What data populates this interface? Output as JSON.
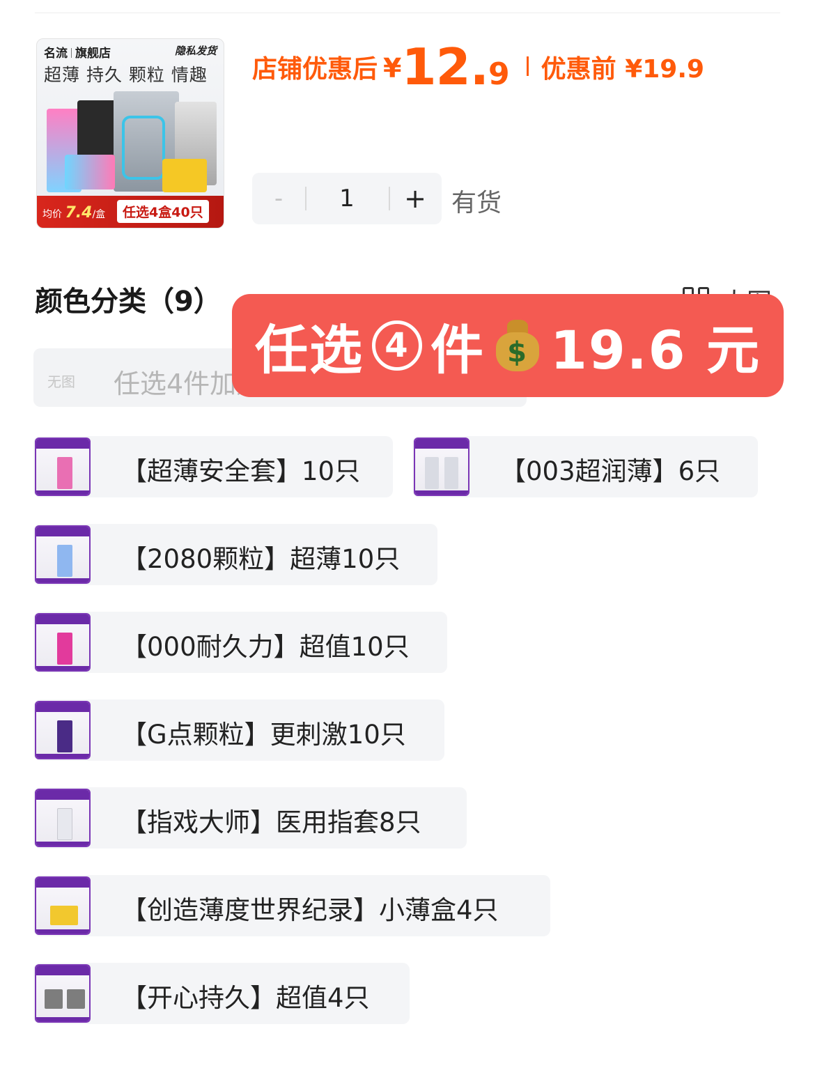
{
  "product": {
    "thumbnail": {
      "brand": "名流",
      "store": "旗舰店",
      "shipping": "隐私发货",
      "slogan": "超薄 持久 颗粒 情趣",
      "avg_price_label": "均价",
      "avg_price_value": "7.4",
      "avg_price_unit": "/盒",
      "promo_text": "任选4盒40只"
    },
    "price": {
      "after_label": "店铺优惠后",
      "currency": "¥",
      "after_int": "12.",
      "after_dec": "9",
      "before_label": "优惠前",
      "before_value": "¥19.9"
    },
    "stepper": {
      "minus": "-",
      "quantity": "1",
      "plus": "+"
    },
    "stock": "有货"
  },
  "category": {
    "title": "颜色分类（9）",
    "view_toggle": "大图",
    "selected_placeholder_img": "无图",
    "selected_text": "任选4件加购后去购物车结算",
    "options": [
      {
        "label": "【超薄安全套】10只",
        "pack_color": "#e96fb3"
      },
      {
        "label": "【003超润薄】6只",
        "pack_color": "#d9dbe3"
      },
      {
        "label": "【2080颗粒】超薄10只",
        "pack_color": "#8fb7f0"
      },
      {
        "label": "【000耐久力】超值10只",
        "pack_color": "#e23a9c"
      },
      {
        "label": "【G点颗粒】更刺激10只",
        "pack_color": "#4a2b86"
      },
      {
        "label": "【指戏大师】医用指套8只",
        "pack_color": "#e7e8ee"
      },
      {
        "label": "【创造薄度世界纪录】小薄盒4只",
        "pack_color": "#f2c82e"
      },
      {
        "label": "【开心持久】超值4只",
        "pack_color": "#7d7d7d"
      }
    ]
  },
  "promo_banner": {
    "part1": "任选",
    "circled": "4",
    "part2": "件",
    "bag_icon": "money-bag-emoji",
    "part3": "19.6 元"
  }
}
